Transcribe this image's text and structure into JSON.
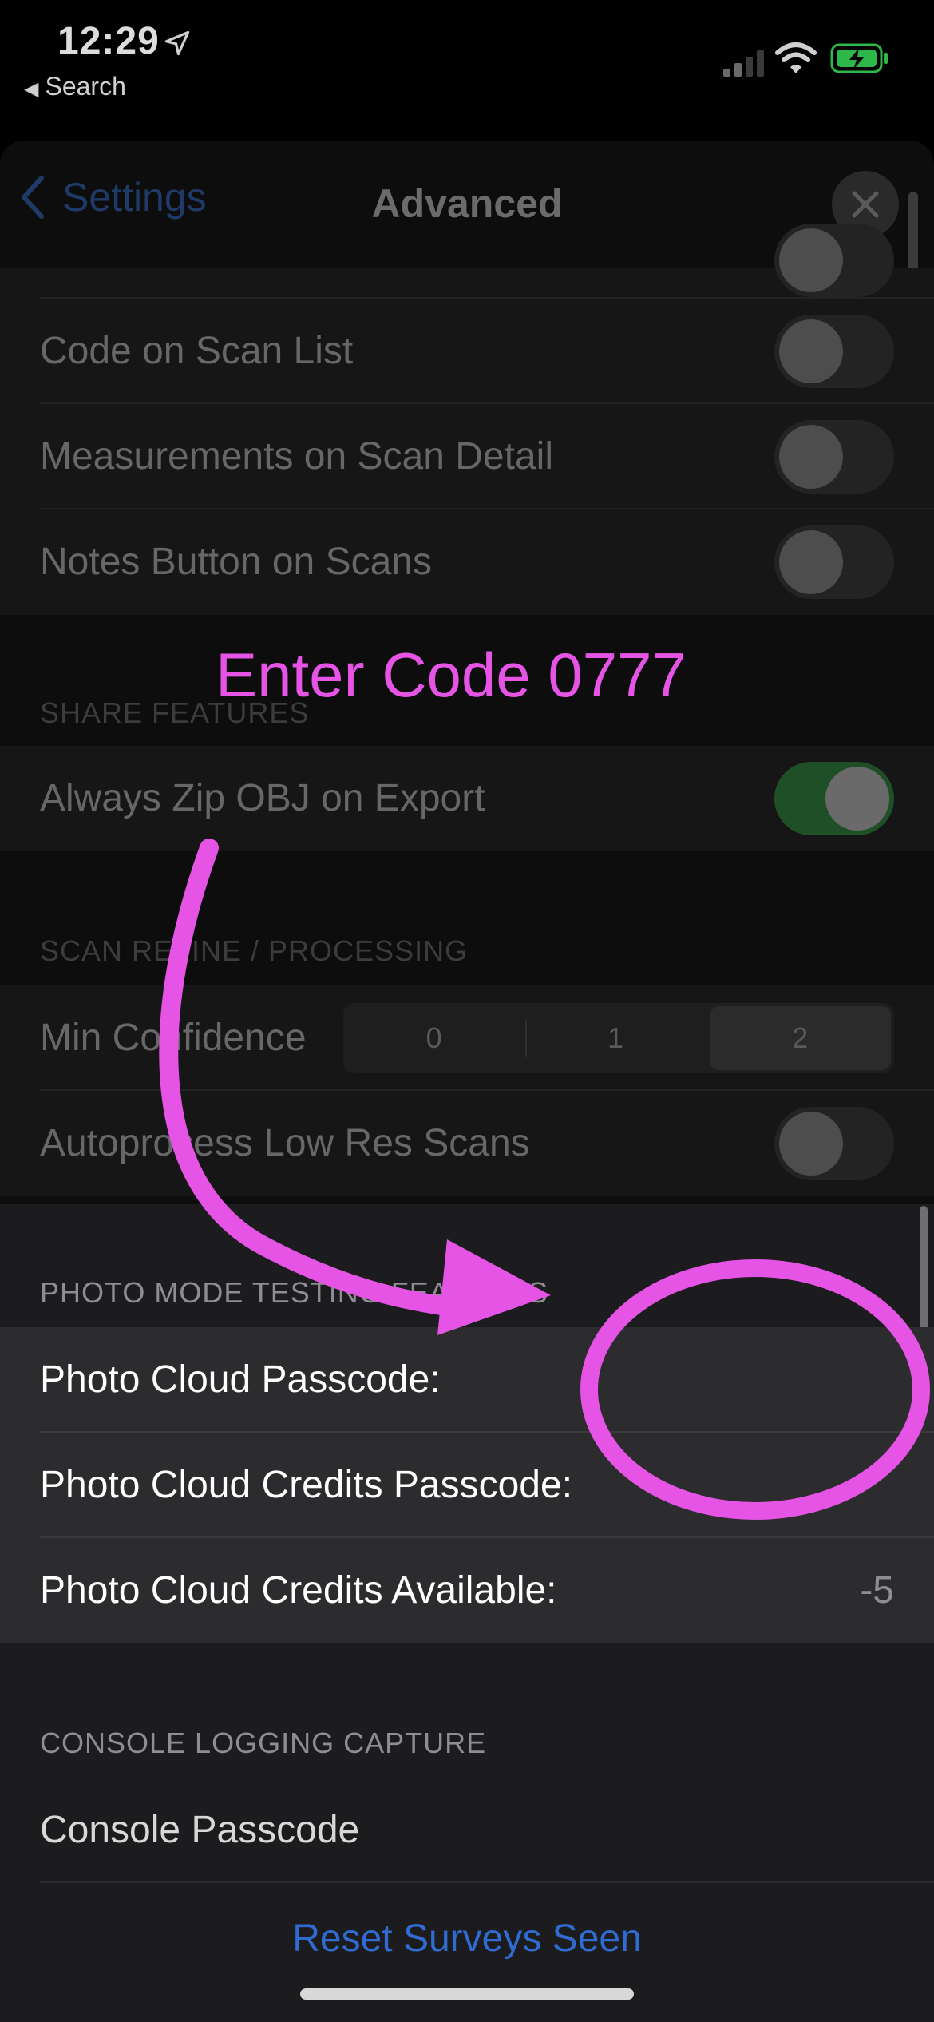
{
  "status_bar": {
    "time": "12:29",
    "back_app": "Search"
  },
  "nav": {
    "back_label": "Settings",
    "title": "Advanced"
  },
  "dimmed_rows": [
    {
      "label": "Code on Scan List",
      "toggle": "off"
    },
    {
      "label": "Measurements on Scan Detail",
      "toggle": "off"
    },
    {
      "label": "Notes Button on Scans",
      "toggle": "off"
    }
  ],
  "share_features": {
    "header": "SHARE FEATURES",
    "rows": [
      {
        "label": "Always Zip OBJ on Export",
        "toggle": "on"
      }
    ]
  },
  "scan_refine": {
    "header": "SCAN REFINE / PROCESSING",
    "min_confidence": {
      "label": "Min Confidence",
      "options": [
        "0",
        "1",
        "2"
      ],
      "selected": "2"
    },
    "autoprocess": {
      "label": "Autoprocess Low Res Scans",
      "toggle": "off"
    }
  },
  "photo_mode": {
    "header": "PHOTO MODE TESTING FEATURES",
    "rows": [
      {
        "label": "Photo Cloud Passcode:",
        "value": ""
      },
      {
        "label": "Photo Cloud Credits Passcode:",
        "value": ""
      },
      {
        "label": "Photo Cloud Credits Available:",
        "value": "-5"
      }
    ]
  },
  "console": {
    "header": "CONSOLE LOGGING CAPTURE",
    "passcode_label": "Console Passcode",
    "reset_label": "Reset Surveys Seen"
  },
  "annotation": {
    "text": "Enter Code 0777",
    "color": "#e654e6"
  }
}
